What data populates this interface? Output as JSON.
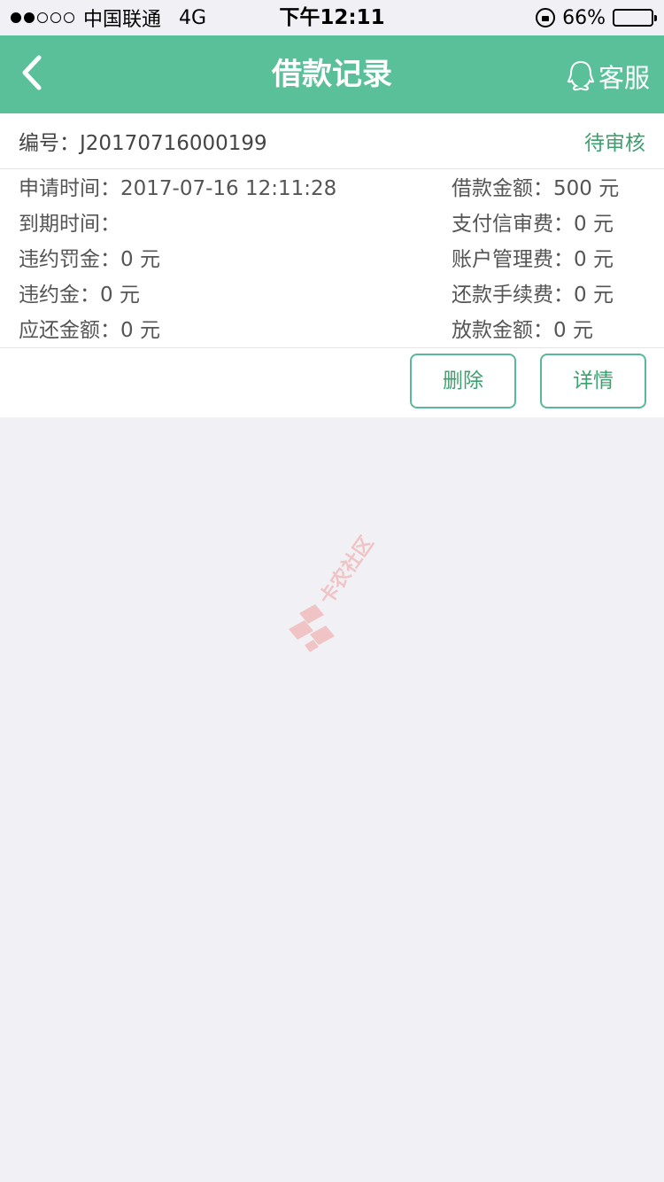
{
  "status_bar": {
    "carrier": "中国联通",
    "network": "4G",
    "time": "下午12:11",
    "battery": "66%",
    "battery_level": 0.66
  },
  "nav": {
    "title": "借款记录",
    "service_label": "客服",
    "back_icon": "chevron-left-icon",
    "service_icon": "qq-icon"
  },
  "record": {
    "number": "编号：J20170716000199",
    "status": "待审核",
    "rows": [
      {
        "left": "申请时间：2017-07-16 12:11:28",
        "right": "借款金额：500 元"
      },
      {
        "left": "到期时间：",
        "right": "支付信审费：0 元"
      },
      {
        "left": "违约罚金：0 元",
        "right": "账户管理费：0 元"
      },
      {
        "left": "违约金：0 元",
        "right": "还款手续费：0 元"
      },
      {
        "left": "应还金额：0 元",
        "right": "放款金额：0 元"
      }
    ],
    "delete_label": "删除",
    "detail_label": "详情"
  },
  "watermark": {
    "text": "卡农社区"
  },
  "colors": {
    "accent": "#5ac09a",
    "status_green": "#3ea06e",
    "background": "#f1f1f5"
  }
}
